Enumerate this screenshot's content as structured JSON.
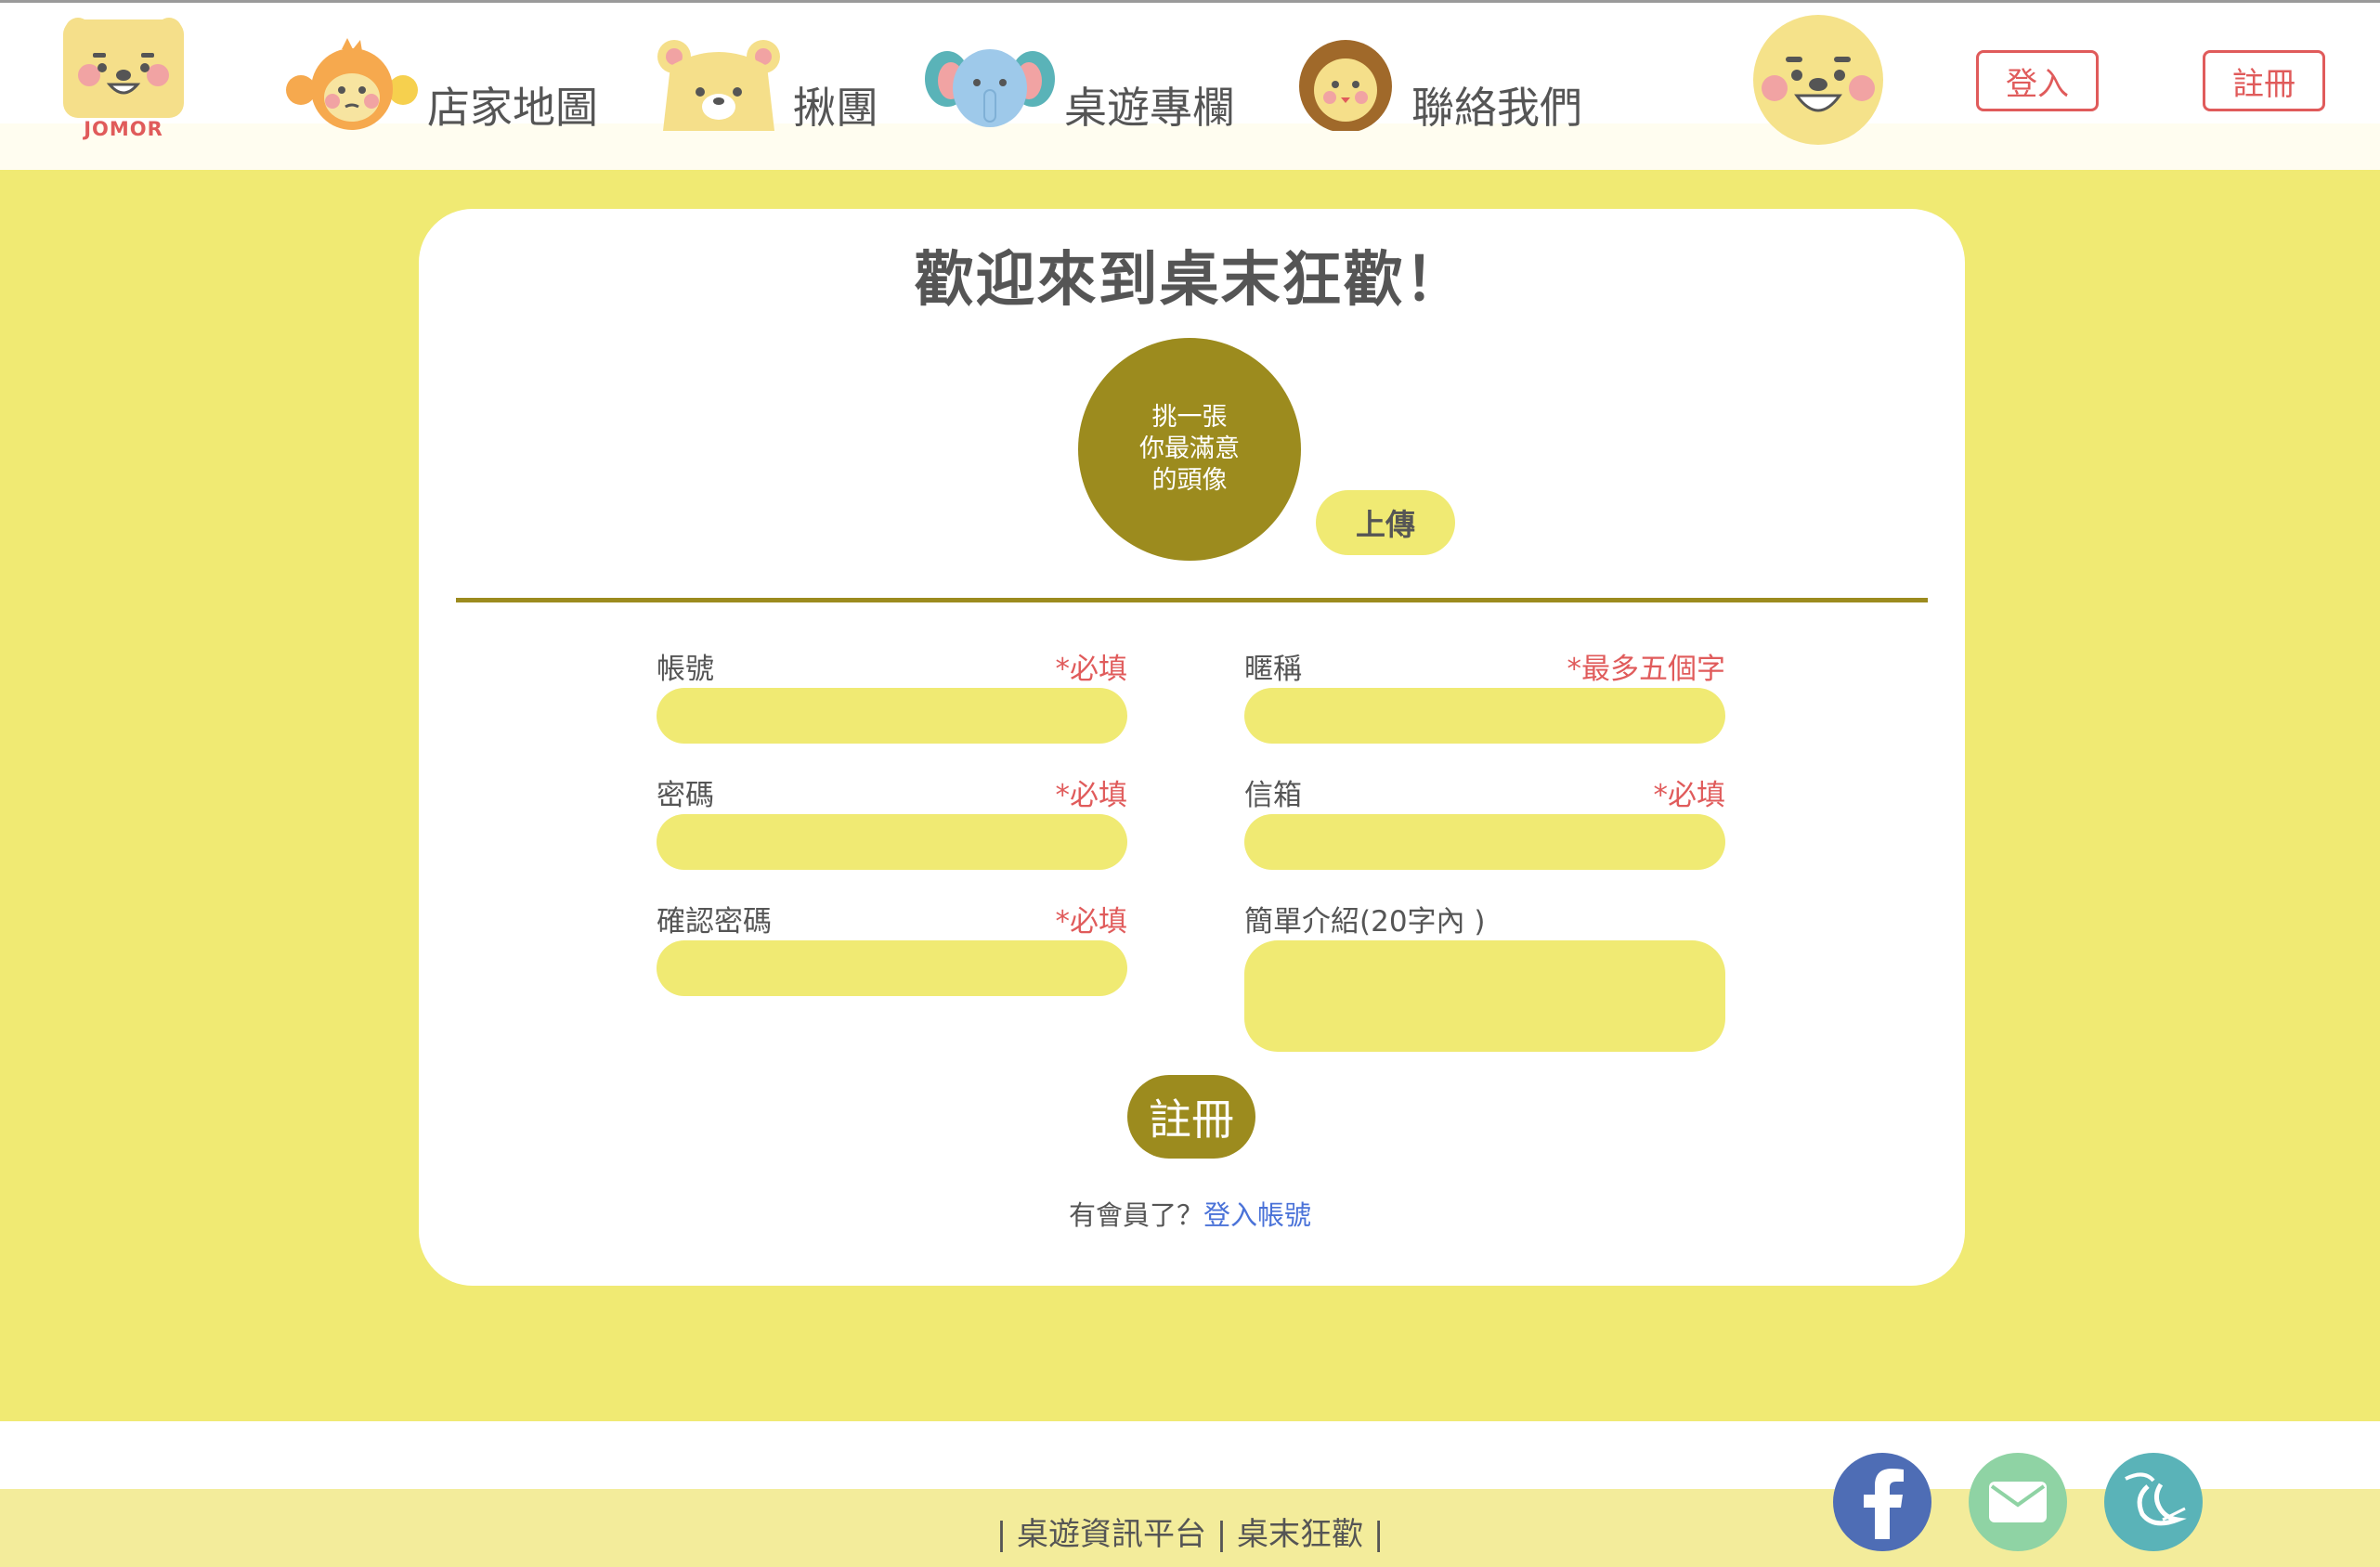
{
  "header": {
    "logo_text": "JOMOR",
    "nav": [
      {
        "label": "店家地圖",
        "icon": "monkey-icon"
      },
      {
        "label": "揪團",
        "icon": "bear-icon"
      },
      {
        "label": "桌遊專欄",
        "icon": "elephant-icon"
      },
      {
        "label": "聯絡我們",
        "icon": "lion-icon"
      }
    ],
    "avatar_icon": "bear-face-icon",
    "login_label": "登入",
    "register_label": "註冊"
  },
  "form": {
    "title": "歡迎來到桌末狂歡！",
    "avatar_prompt": [
      "挑一張",
      "你最滿意",
      "的頭像"
    ],
    "upload_label": "上傳",
    "fields": {
      "account": {
        "label": "帳號",
        "note": "*必填"
      },
      "password": {
        "label": "密碼",
        "note": "*必填"
      },
      "confirm_password": {
        "label": "確認密碼",
        "note": "*必填"
      },
      "nickname": {
        "label": "暱稱",
        "note": "*最多五個字"
      },
      "email": {
        "label": "信箱",
        "note": "*必填"
      },
      "intro": {
        "label": "簡單介紹(20字內 )"
      }
    },
    "submit_label": "註冊",
    "login_prompt": "有會員了？",
    "login_link": "登入帳號"
  },
  "footer": {
    "text": "| 桌遊資訊平台 | 桌末狂歡 |",
    "social": [
      {
        "icon": "facebook-icon",
        "color": "#4e6db5"
      },
      {
        "icon": "mail-icon",
        "color": "#8fd3a4"
      },
      {
        "icon": "swan-icon",
        "color": "#5ab3b8"
      }
    ]
  },
  "colors": {
    "accent_yellow": "#f0ea73",
    "olive": "#9c8b1e",
    "required_red": "#e05b5b",
    "link_blue": "#4a72d8"
  }
}
